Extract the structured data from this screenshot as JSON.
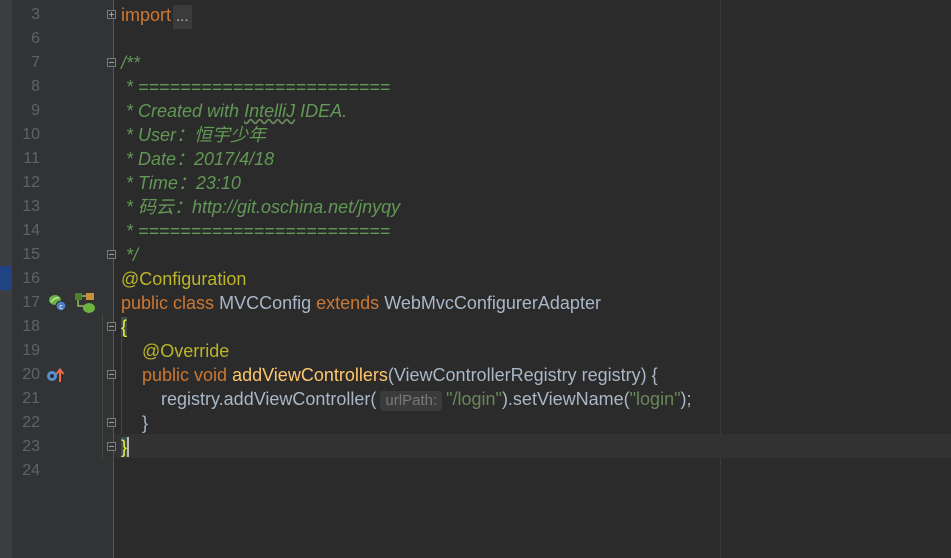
{
  "gutter": {
    "line_numbers": [
      "3",
      "6",
      "7",
      "8",
      "9",
      "10",
      "11",
      "12",
      "13",
      "14",
      "15",
      "16",
      "17",
      "18",
      "19",
      "20",
      "21",
      "22",
      "23",
      "24"
    ]
  },
  "code": {
    "import_kw": "import",
    "import_fold": "...",
    "c_open": "/**",
    "c_sep1": " * ========================",
    "c_created": " * Created with ",
    "c_intellij": "IntelliJ",
    "c_idea": " IDEA.",
    "c_user": " * User：恒宇少年",
    "c_date": " * Date：2017/4/18",
    "c_time": " * Time：23:10",
    "c_repo": " * 码云：http://git.oschina.net/jnyqy",
    "c_sep2": " * ========================",
    "c_close": " */",
    "annotation_config": "@Configuration",
    "kw_public": "public",
    "kw_class": "class",
    "class_name": "MVCConfig",
    "kw_extends": "extends",
    "super_class": "WebMvcConfigurerAdapter",
    "open_brace": "{",
    "annotation_override": "@Override",
    "kw_public2": "public",
    "kw_void": "void",
    "method_name": "addViewControllers",
    "params": "(ViewControllerRegistry registry) {",
    "call_start": "registry.addViewController(",
    "param_hint": "urlPath:",
    "str_login_path": "\"/login\"",
    "call_mid": ").setViewName(",
    "str_login": "\"login\"",
    "call_end": ");",
    "method_close": "}",
    "class_close": "}"
  }
}
